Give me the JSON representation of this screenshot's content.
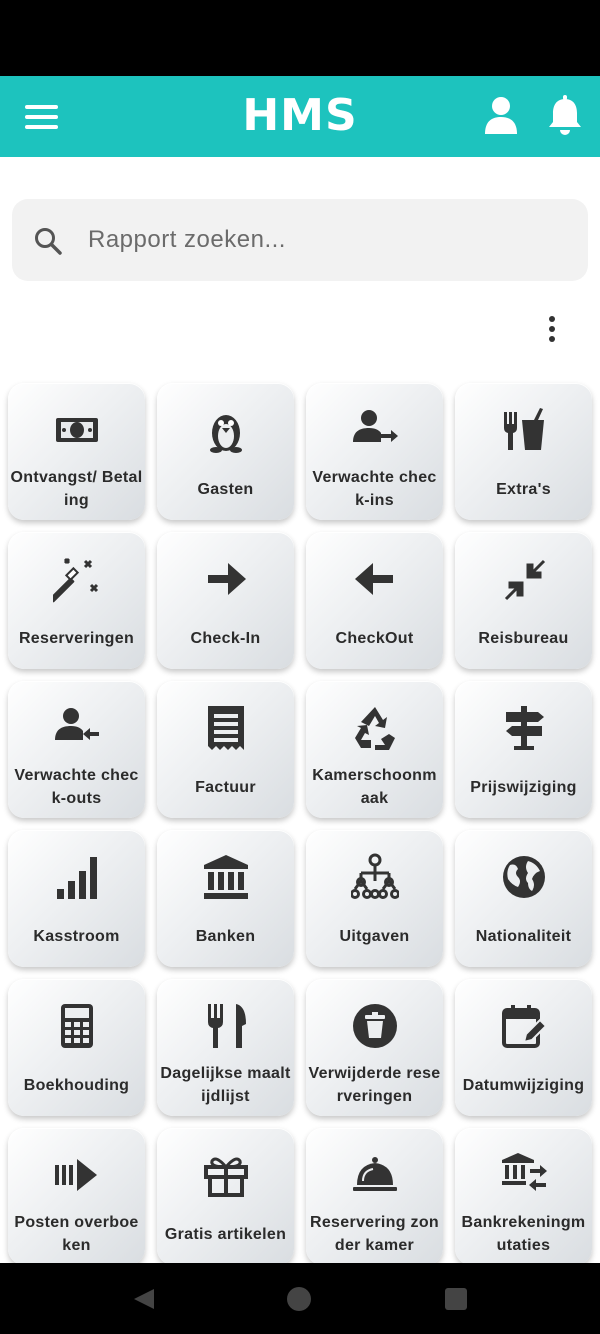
{
  "app_bar": {
    "logo": "HMS",
    "color": "#1dc3be"
  },
  "search": {
    "placeholder": "Rapport zoeken..."
  },
  "tiles": [
    {
      "label": "Ontvangst/ Betaling",
      "icon": "money-icon"
    },
    {
      "label": "Gasten",
      "icon": "penguin-icon"
    },
    {
      "label": "Verwachte check-ins",
      "icon": "user-arrow-right-icon"
    },
    {
      "label": "Extra's",
      "icon": "fork-cup-icon"
    },
    {
      "label": "Reserveringen",
      "icon": "magic-wand-icon"
    },
    {
      "label": "Check-In",
      "icon": "arrow-right-icon"
    },
    {
      "label": "CheckOut",
      "icon": "arrow-left-icon"
    },
    {
      "label": "Reisbureau",
      "icon": "compress-icon"
    },
    {
      "label": "Verwachte check-outs",
      "icon": "user-arrow-left-icon"
    },
    {
      "label": "Factuur",
      "icon": "receipt-icon"
    },
    {
      "label": "Kamerschoonmaak",
      "icon": "recycle-icon"
    },
    {
      "label": "Prijswijziging",
      "icon": "signpost-icon"
    },
    {
      "label": "Kasstroom",
      "icon": "signal-bars-icon"
    },
    {
      "label": "Banken",
      "icon": "bank-icon"
    },
    {
      "label": "Uitgaven",
      "icon": "sitemap-icon"
    },
    {
      "label": "Nationaliteit",
      "icon": "globe-icon"
    },
    {
      "label": "Boekhouding",
      "icon": "calculator-icon"
    },
    {
      "label": "Dagelijkse maaltijdlijst",
      "icon": "utensils-icon"
    },
    {
      "label": "Verwijderde reserveringen",
      "icon": "trash-circle-icon"
    },
    {
      "label": "Datumwijziging",
      "icon": "calendar-edit-icon"
    },
    {
      "label": "Posten overboeken",
      "icon": "forward-bars-icon"
    },
    {
      "label": "Gratis artikelen",
      "icon": "gift-icon"
    },
    {
      "label": "Reservering zonder kamer",
      "icon": "cloche-icon"
    },
    {
      "label": "Bankrekeningmutaties",
      "icon": "bank-transfer-icon"
    }
  ]
}
